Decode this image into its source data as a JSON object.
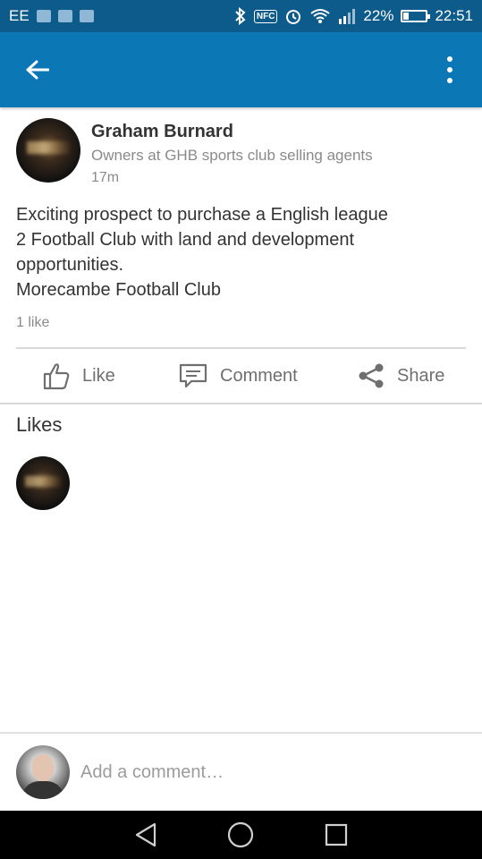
{
  "status_bar": {
    "carrier": "EE",
    "battery": "22%",
    "time": "22:51",
    "nfc_label": "NFC"
  },
  "app_bar": {
    "back_icon": "arrow-left-icon",
    "menu_icon": "more-vert-icon"
  },
  "post": {
    "author_name": "Graham Burnard",
    "author_headline": "Owners at GHB sports club selling agents",
    "time": "17m",
    "text_lines": [
      "Exciting prospect to purchase a English league",
      "2 Football Club with land and development",
      "opportunities.",
      "Morecambe Football Club"
    ],
    "likes_count": "1 like"
  },
  "actions": {
    "like_label": "Like",
    "comment_label": "Comment",
    "share_label": "Share"
  },
  "likes_section": {
    "title": "Likes"
  },
  "comment_bar": {
    "placeholder": "Add a comment…"
  },
  "colors": {
    "status_bar": "#0d5b8a",
    "app_bar": "#0b77b5",
    "secondary_text": "#8a8a8a"
  }
}
